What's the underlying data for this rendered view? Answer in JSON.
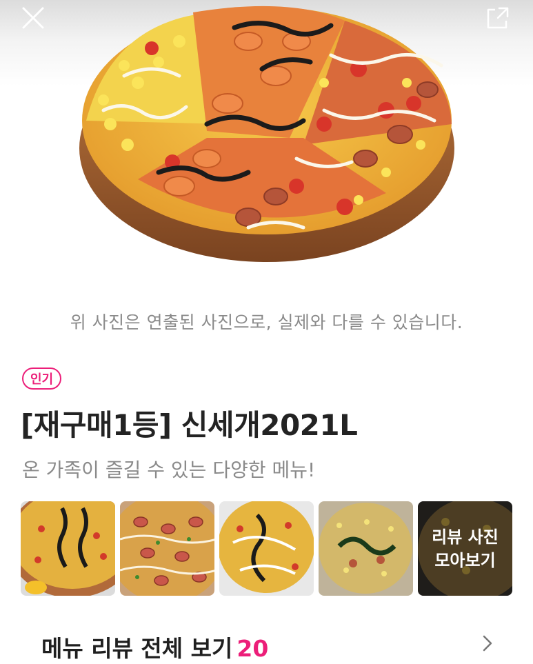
{
  "header": {
    "close_icon": "close-icon",
    "share_icon": "share-icon"
  },
  "hero": {
    "image": "pizza-photo"
  },
  "notice_text": "위 사진은 연출된 사진으로, 실제와 다를 수 있습니다.",
  "product": {
    "badge": "인기",
    "title": "[재구매1등] 신세개2021L",
    "subtitle": "온 가족이 즐길 수 있는 다양한 메뉴!"
  },
  "review_photos": {
    "more_label_line1": "리뷰 사진",
    "more_label_line2": "모아보기"
  },
  "reviews": {
    "label": "메뉴 리뷰 전체 보기",
    "count": "20"
  },
  "colors": {
    "accent": "#ec1e79",
    "title": "#232323",
    "muted": "#8a8a8a"
  }
}
